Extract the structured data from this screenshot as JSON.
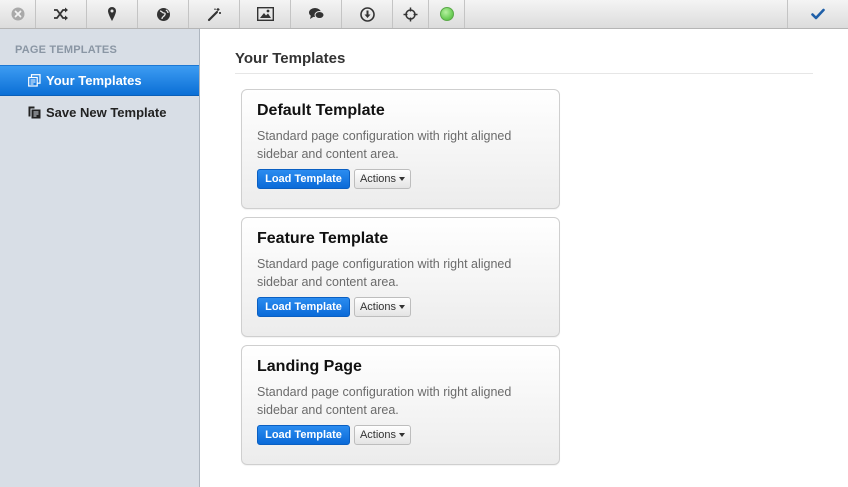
{
  "toolbar": {
    "icons": [
      "close-icon",
      "shuffle-icon",
      "map-pin-icon",
      "globe-icon",
      "magic-wand-icon",
      "image-icon",
      "comments-icon",
      "download-icon",
      "crosshair-icon",
      "status-dot-icon",
      "checkmark-icon"
    ],
    "status_color": "#6fcf5a",
    "confirm_color": "#1f5fa8"
  },
  "sidebar": {
    "heading": "PAGE TEMPLATES",
    "items": [
      {
        "label": "Your Templates",
        "icon": "templates-icon",
        "active": true
      },
      {
        "label": "Save New Template",
        "icon": "copy-icon",
        "active": false
      }
    ],
    "active_color": "#1a7fe6"
  },
  "main": {
    "title": "Your Templates",
    "templates": [
      {
        "title": "Default Template",
        "description": "Standard page configuration with right aligned sidebar and content area.",
        "load_label": "Load Template",
        "actions_label": "Actions"
      },
      {
        "title": "Feature Template",
        "description": "Standard page configuration with right aligned sidebar and content area.",
        "load_label": "Load Template",
        "actions_label": "Actions"
      },
      {
        "title": "Landing Page",
        "description": "Standard page configuration with right aligned sidebar and content area.",
        "load_label": "Load Template",
        "actions_label": "Actions"
      }
    ]
  }
}
